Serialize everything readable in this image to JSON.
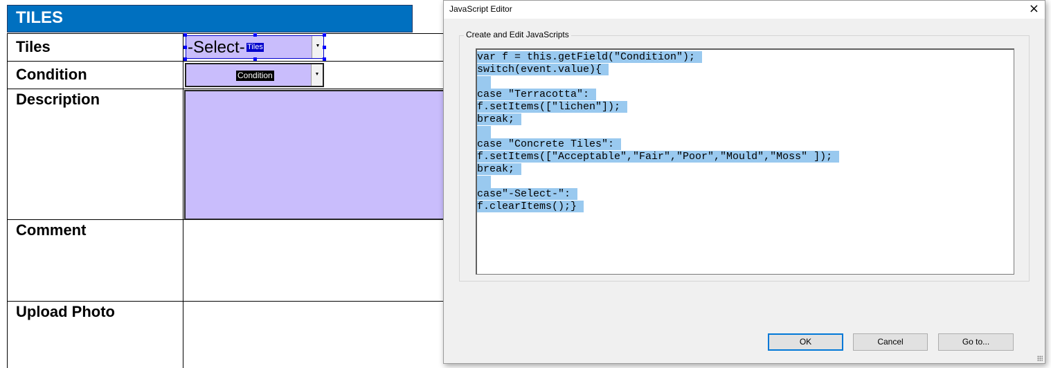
{
  "form": {
    "header": "TILES",
    "rows": {
      "tiles": "Tiles",
      "condition": "Condition",
      "description": "Description",
      "comment": "Comment",
      "upload_photo": "Upload Photo"
    },
    "tiles_field": {
      "value": "-Select-",
      "field_name": "Tiles"
    },
    "condition_field": {
      "field_name": "Condition"
    },
    "dropdown_arrow": "▼",
    "field_color": "#c9bdfc",
    "header_color": "#0070c0"
  },
  "dialog": {
    "title": "JavaScript Editor",
    "close_icon": "×",
    "group_label": "Create and Edit JavaScripts",
    "code_lines": [
      "var f = this.getField(\"Condition\");",
      "switch(event.value){",
      "",
      "case \"Terracotta\":",
      "f.setItems([\"lichen\"]);",
      "break;",
      "",
      "case \"Concrete Tiles\":",
      "f.setItems([\"Acceptable\",\"Fair\",\"Poor\",\"Mould\",\"Moss\" ]);",
      "break;",
      "",
      "case\"-Select-\":",
      "f.clearItems();}"
    ],
    "selection_color": "#99c9ef",
    "buttons": {
      "ok": "OK",
      "cancel": "Cancel",
      "goto": "Go to..."
    }
  }
}
